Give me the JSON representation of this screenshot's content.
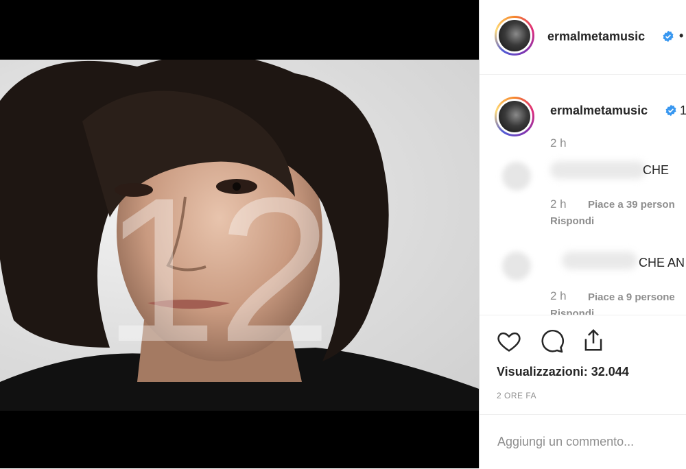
{
  "post": {
    "overlay_number": "12"
  },
  "header": {
    "username": "ermalmetamusic",
    "verified": true,
    "separator": "•"
  },
  "caption": {
    "username": "ermalmetamusic",
    "trailing": "1",
    "time": "2 h"
  },
  "comments": [
    {
      "text_fragment": "CHE",
      "time": "2 h",
      "likes": "Piace a 39 person",
      "reply": "Rispondi"
    },
    {
      "text_fragment": "CHE AN",
      "time": "2 h",
      "likes": "Piace a 9 persone",
      "reply": "Rispondi"
    }
  ],
  "actions": {
    "like_icon": "heart-icon",
    "comment_icon": "comment-icon",
    "share_icon": "share-icon",
    "views_label": "Visualizzazioni:",
    "views_count": "32.044",
    "posted_ago": "2 ORE FA"
  },
  "add_comment": {
    "placeholder": "Aggiungi un commento..."
  },
  "colors": {
    "verified": "#3897f0",
    "text": "#262626",
    "muted": "#8e8e8e"
  }
}
